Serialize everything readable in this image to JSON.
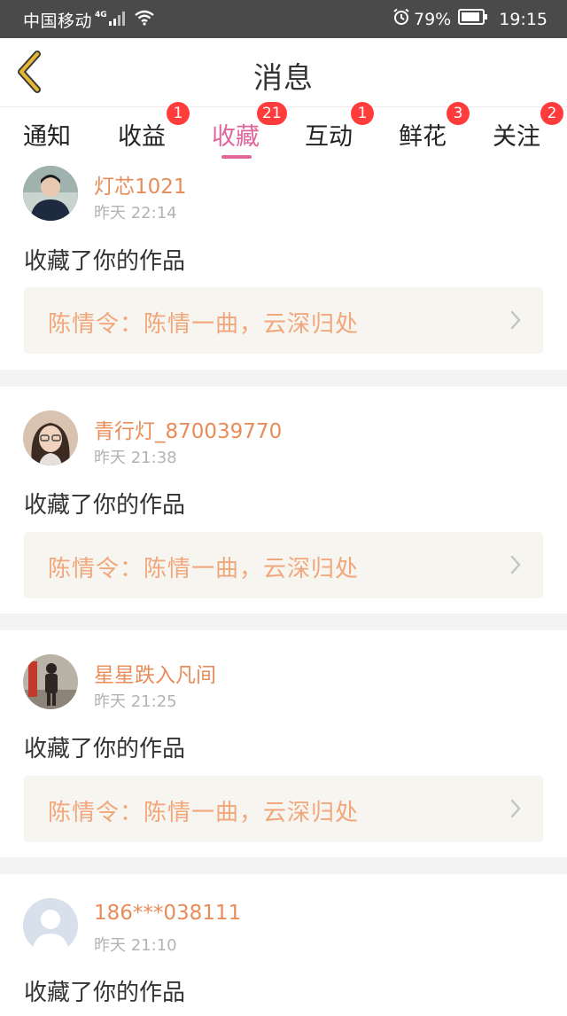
{
  "status_bar": {
    "carrier": "中国移动",
    "network": "4G",
    "battery_percent": "79%",
    "time": "19:15"
  },
  "header": {
    "title": "消息"
  },
  "tabs": [
    {
      "label": "通知",
      "badge": ""
    },
    {
      "label": "收益",
      "badge": "1"
    },
    {
      "label": "收藏",
      "badge": "21",
      "active": true
    },
    {
      "label": "互动",
      "badge": "1"
    },
    {
      "label": "鲜花",
      "badge": "3"
    },
    {
      "label": "关注",
      "badge": "2"
    }
  ],
  "messages": [
    {
      "username": "灯芯1021",
      "time": "昨天 22:14",
      "action": "收藏了你的作品",
      "work_title": "陈情令：陈情一曲，云深归处"
    },
    {
      "username": "青行灯_870039770",
      "time": "昨天 21:38",
      "action": "收藏了你的作品",
      "work_title": "陈情令：陈情一曲，云深归处"
    },
    {
      "username": "星星跌入凡间",
      "time": "昨天 21:25",
      "action": "收藏了你的作品",
      "work_title": "陈情令：陈情一曲，云深归处"
    },
    {
      "username": "186***038111",
      "time": "昨天 21:10",
      "action": "收藏了你的作品"
    }
  ],
  "colors": {
    "accent_pink": "#e0659a",
    "username_orange": "#e88c5a",
    "work_title_orange": "#f2a67c",
    "badge_red": "#ff3b3b",
    "back_arrow_gold": "#e5b833"
  }
}
